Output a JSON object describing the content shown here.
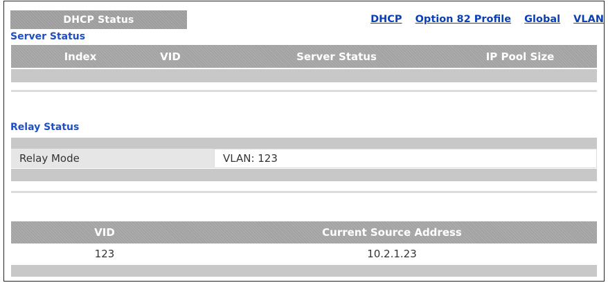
{
  "header": {
    "title": "DHCP Status",
    "links": [
      "DHCP",
      "Option 82 Profile",
      "Global",
      "VLAN"
    ]
  },
  "server_status": {
    "title": "Server Status",
    "columns": [
      "Index",
      "VID",
      "Server Status",
      "IP Pool Size"
    ]
  },
  "relay_status": {
    "title": "Relay Status",
    "relay_mode_label": "Relay Mode",
    "relay_mode_value": "VLAN: 123"
  },
  "source_table": {
    "columns": [
      "VID",
      "Current Source Address"
    ],
    "rows": [
      {
        "vid": "123",
        "address": "10.2.1.23"
      }
    ]
  },
  "colors": {
    "accent": "#1f4fc0",
    "link": "#0a3fb5",
    "header_bar": "#a3a3a3",
    "row_bar": "#c8c8c8"
  }
}
